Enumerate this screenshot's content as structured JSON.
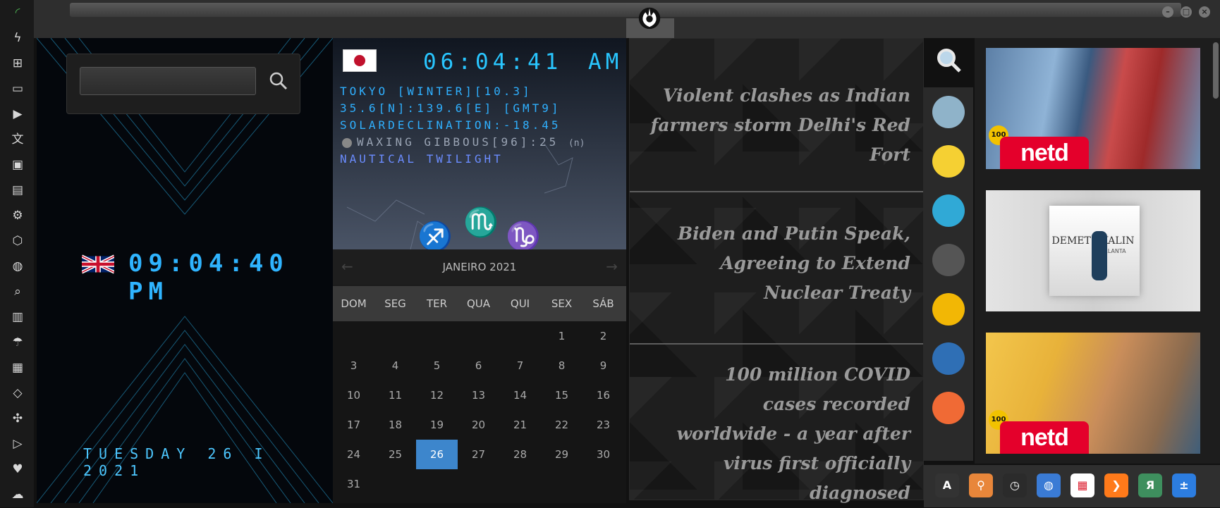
{
  "sidebar": {
    "icons": [
      "wifi-icon",
      "lightning-icon",
      "windows-icon",
      "archive-icon",
      "play-icon",
      "translate-icon",
      "image-icon",
      "news-icon",
      "steam-icon",
      "hexagon-icon",
      "globe-icon",
      "search-icon",
      "map-icon",
      "umbrella-icon",
      "contacts-icon",
      "code-icon",
      "expand-icon",
      "youtube-icon",
      "heart-icon",
      "cloud-icon"
    ]
  },
  "window": {
    "logo": "rebel-alliance-logo",
    "controls": [
      "minimize",
      "maximize",
      "close"
    ]
  },
  "search": {
    "placeholder": "",
    "value": ""
  },
  "clock_uk": {
    "flag": "uk-flag",
    "time": "09:04:40 PM",
    "date": "TUESDAY 26 I 2021"
  },
  "clock_jp": {
    "flag": "japan-flag",
    "time": "06:04:41",
    "ampm": "AM",
    "lines": [
      "TOKYO [WINTER][10.3]",
      "35.6[N]:139.6[E] [GMT9]",
      "SOLARDECLINATION:-18.45",
      "WAXING GIBBOUS[96]:25",
      "NAUTICAL TWILIGHT"
    ],
    "moon_suffix": "(n)"
  },
  "calendar": {
    "month": "JANEIRO 2021",
    "prev": "←",
    "next": "→",
    "days_of_week": [
      "DOM",
      "SEG",
      "TER",
      "QUA",
      "QUI",
      "SEX",
      "SÁB"
    ],
    "first_weekday": 5,
    "days_in_month": 31,
    "today": 26
  },
  "news": {
    "items": [
      "Violent clashes as Indian farmers storm Delhi's Red Fort",
      "Biden and Putin Speak, Agreeing to Extend Nuclear Treaty",
      "100 million COVID cases recorded worldwide - a year after virus first officially diagnosed"
    ]
  },
  "dock": {
    "icons": [
      "search-icon",
      "radio-tower-icon",
      "pikachu-icon",
      "cloud-music-icon",
      "clapperboard-icon",
      "compass-icon",
      "blueprint-icon",
      "restaurant-icon"
    ],
    "colors": [
      "#9e9e9e",
      "#8fb3c9",
      "#f5d033",
      "#30a9d6",
      "#555555",
      "#f2b705",
      "#2f6fb5",
      "#f06a35"
    ]
  },
  "videos": [
    {
      "brand": "netd",
      "badge": "100"
    },
    {
      "brand": "",
      "badge": "",
      "title": "DEMET AKALIN",
      "subtitle": "PIRLANTA"
    },
    {
      "brand": "netd",
      "badge": "100"
    }
  ],
  "taskbar": {
    "icons": [
      "autodesk-icon",
      "search-orange-icon",
      "clock-icon",
      "globe-icon",
      "calendar-icon",
      "arrow-icon",
      "yandex-icon",
      "calculator-icon"
    ],
    "glyphs": [
      "A",
      "⚲",
      "◷",
      "◍",
      "▦",
      "❯",
      "Я",
      "±"
    ],
    "colors": [
      "#333333",
      "#e8863a",
      "#2b2b2b",
      "#3a7bd5",
      "#ffffff",
      "#ff7a1a",
      "#3e8f5e",
      "#2c7de0"
    ]
  }
}
